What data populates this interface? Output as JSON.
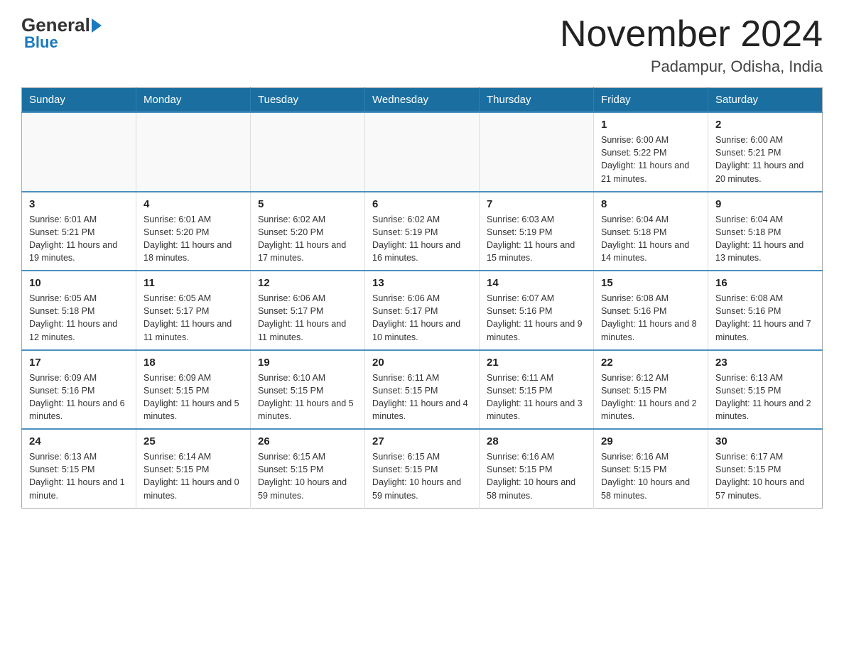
{
  "header": {
    "logo_general": "General",
    "logo_blue": "Blue",
    "month_year": "November 2024",
    "location": "Padampur, Odisha, India"
  },
  "weekdays": [
    "Sunday",
    "Monday",
    "Tuesday",
    "Wednesday",
    "Thursday",
    "Friday",
    "Saturday"
  ],
  "weeks": [
    [
      {
        "day": "",
        "info": ""
      },
      {
        "day": "",
        "info": ""
      },
      {
        "day": "",
        "info": ""
      },
      {
        "day": "",
        "info": ""
      },
      {
        "day": "",
        "info": ""
      },
      {
        "day": "1",
        "info": "Sunrise: 6:00 AM\nSunset: 5:22 PM\nDaylight: 11 hours and 21 minutes."
      },
      {
        "day": "2",
        "info": "Sunrise: 6:00 AM\nSunset: 5:21 PM\nDaylight: 11 hours and 20 minutes."
      }
    ],
    [
      {
        "day": "3",
        "info": "Sunrise: 6:01 AM\nSunset: 5:21 PM\nDaylight: 11 hours and 19 minutes."
      },
      {
        "day": "4",
        "info": "Sunrise: 6:01 AM\nSunset: 5:20 PM\nDaylight: 11 hours and 18 minutes."
      },
      {
        "day": "5",
        "info": "Sunrise: 6:02 AM\nSunset: 5:20 PM\nDaylight: 11 hours and 17 minutes."
      },
      {
        "day": "6",
        "info": "Sunrise: 6:02 AM\nSunset: 5:19 PM\nDaylight: 11 hours and 16 minutes."
      },
      {
        "day": "7",
        "info": "Sunrise: 6:03 AM\nSunset: 5:19 PM\nDaylight: 11 hours and 15 minutes."
      },
      {
        "day": "8",
        "info": "Sunrise: 6:04 AM\nSunset: 5:18 PM\nDaylight: 11 hours and 14 minutes."
      },
      {
        "day": "9",
        "info": "Sunrise: 6:04 AM\nSunset: 5:18 PM\nDaylight: 11 hours and 13 minutes."
      }
    ],
    [
      {
        "day": "10",
        "info": "Sunrise: 6:05 AM\nSunset: 5:18 PM\nDaylight: 11 hours and 12 minutes."
      },
      {
        "day": "11",
        "info": "Sunrise: 6:05 AM\nSunset: 5:17 PM\nDaylight: 11 hours and 11 minutes."
      },
      {
        "day": "12",
        "info": "Sunrise: 6:06 AM\nSunset: 5:17 PM\nDaylight: 11 hours and 11 minutes."
      },
      {
        "day": "13",
        "info": "Sunrise: 6:06 AM\nSunset: 5:17 PM\nDaylight: 11 hours and 10 minutes."
      },
      {
        "day": "14",
        "info": "Sunrise: 6:07 AM\nSunset: 5:16 PM\nDaylight: 11 hours and 9 minutes."
      },
      {
        "day": "15",
        "info": "Sunrise: 6:08 AM\nSunset: 5:16 PM\nDaylight: 11 hours and 8 minutes."
      },
      {
        "day": "16",
        "info": "Sunrise: 6:08 AM\nSunset: 5:16 PM\nDaylight: 11 hours and 7 minutes."
      }
    ],
    [
      {
        "day": "17",
        "info": "Sunrise: 6:09 AM\nSunset: 5:16 PM\nDaylight: 11 hours and 6 minutes."
      },
      {
        "day": "18",
        "info": "Sunrise: 6:09 AM\nSunset: 5:15 PM\nDaylight: 11 hours and 5 minutes."
      },
      {
        "day": "19",
        "info": "Sunrise: 6:10 AM\nSunset: 5:15 PM\nDaylight: 11 hours and 5 minutes."
      },
      {
        "day": "20",
        "info": "Sunrise: 6:11 AM\nSunset: 5:15 PM\nDaylight: 11 hours and 4 minutes."
      },
      {
        "day": "21",
        "info": "Sunrise: 6:11 AM\nSunset: 5:15 PM\nDaylight: 11 hours and 3 minutes."
      },
      {
        "day": "22",
        "info": "Sunrise: 6:12 AM\nSunset: 5:15 PM\nDaylight: 11 hours and 2 minutes."
      },
      {
        "day": "23",
        "info": "Sunrise: 6:13 AM\nSunset: 5:15 PM\nDaylight: 11 hours and 2 minutes."
      }
    ],
    [
      {
        "day": "24",
        "info": "Sunrise: 6:13 AM\nSunset: 5:15 PM\nDaylight: 11 hours and 1 minute."
      },
      {
        "day": "25",
        "info": "Sunrise: 6:14 AM\nSunset: 5:15 PM\nDaylight: 11 hours and 0 minutes."
      },
      {
        "day": "26",
        "info": "Sunrise: 6:15 AM\nSunset: 5:15 PM\nDaylight: 10 hours and 59 minutes."
      },
      {
        "day": "27",
        "info": "Sunrise: 6:15 AM\nSunset: 5:15 PM\nDaylight: 10 hours and 59 minutes."
      },
      {
        "day": "28",
        "info": "Sunrise: 6:16 AM\nSunset: 5:15 PM\nDaylight: 10 hours and 58 minutes."
      },
      {
        "day": "29",
        "info": "Sunrise: 6:16 AM\nSunset: 5:15 PM\nDaylight: 10 hours and 58 minutes."
      },
      {
        "day": "30",
        "info": "Sunrise: 6:17 AM\nSunset: 5:15 PM\nDaylight: 10 hours and 57 minutes."
      }
    ]
  ]
}
